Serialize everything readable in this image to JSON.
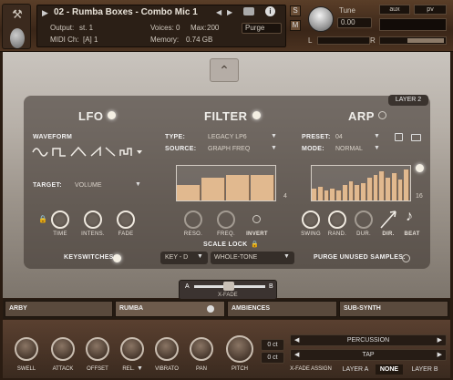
{
  "header": {
    "instrument_name": "02 - Rumba Boxes - Combo Mic 1",
    "output_label": "Output:",
    "output_value": "st. 1",
    "voices_label": "Voices:",
    "voices_value": "0",
    "max_label": "Max:",
    "max_value": "200",
    "midi_label": "MIDI Ch:",
    "midi_value": "[A] 1",
    "memory_label": "Memory:",
    "memory_value": "0.74 GB",
    "purge_label": "Purge",
    "tune_label": "Tune",
    "tune_value": "0.00",
    "aux_label": "aux",
    "pv_label": "pv",
    "solo_label": "S",
    "mute_label": "M",
    "lr_l": "L",
    "lr_r": "R"
  },
  "layer_tag": "LAYER 2",
  "lfo": {
    "title": "LFO",
    "waveform_label": "WAVEFORM",
    "target_label": "TARGET:",
    "target_value": "VOLUME",
    "knobs": [
      "TIME",
      "INTENS.",
      "FADE"
    ]
  },
  "filter": {
    "title": "FILTER",
    "type_label": "TYPE:",
    "type_value": "LEGACY LP6",
    "source_label": "SOURCE:",
    "source_value": "GRAPH FREQ",
    "step_count": "4",
    "steps": [
      0.45,
      0.65,
      0.75,
      0.75
    ],
    "knobs": [
      "RESO.",
      "FREQ.",
      "INVERT"
    ],
    "scale_lock_label": "SCALE LOCK",
    "key_value": "KEY - D",
    "scale_value": "WHOLE-TONE"
  },
  "arp": {
    "title": "ARP",
    "preset_label": "PRESET:",
    "preset_value": "04",
    "mode_label": "MODE:",
    "mode_value": "NORMAL",
    "step_count": "16",
    "steps": [
      0.35,
      0.4,
      0.3,
      0.35,
      0.3,
      0.45,
      0.55,
      0.45,
      0.5,
      0.65,
      0.75,
      0.85,
      0.65,
      0.8,
      0.6,
      0.9
    ],
    "knobs": [
      "SWING",
      "RAND.",
      "DUR.",
      "DIR.",
      "BEAT"
    ]
  },
  "keyswitches_label": "KEYSWITCHES:",
  "purge_unused_label": "PURGE UNUSED SAMPLES:",
  "xfade": {
    "a": "A",
    "b": "B",
    "label": "X-FADE"
  },
  "layers": [
    "ARBY",
    "RUMBA",
    "AMBIENCES",
    "SUB-SYNTH"
  ],
  "bottom": {
    "knobs": [
      "SWELL",
      "ATTACK",
      "OFFSET",
      "REL.",
      "VIBRATO",
      "PAN",
      "PITCH"
    ],
    "pitch_values": [
      "0 ct",
      "0 ct"
    ],
    "percussion_label": "PERCUSSION",
    "tap_label": "TAP",
    "xfade_assign_label": "X-FADE ASSIGN",
    "layer_a_label": "LAYER A",
    "none_label": "NONE",
    "layer_b_label": "LAYER B"
  },
  "colors": {
    "accent": "#e1b98f",
    "panel": "#3a2618",
    "glass": "#b7b0a8"
  }
}
